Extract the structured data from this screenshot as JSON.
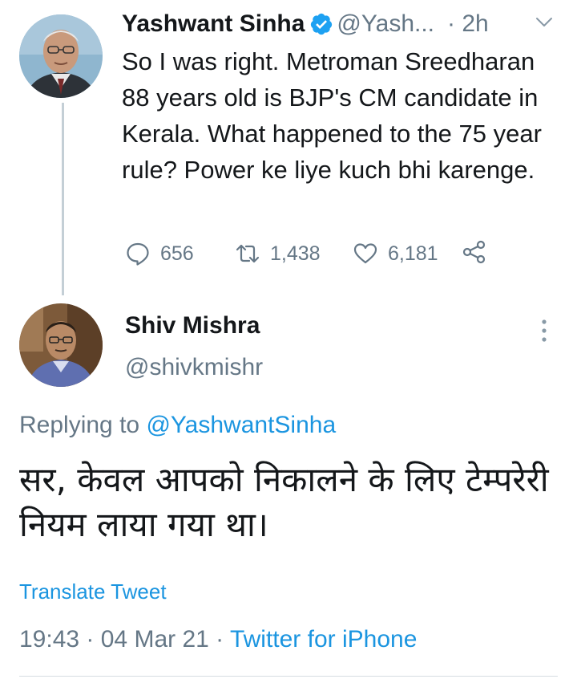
{
  "parent_tweet": {
    "author_name": "Yashwant Sinha",
    "handle": "@Yash...",
    "time": "· 2h",
    "text": "So I was right. Metroman Sreedharan 88 years old is BJP's CM candidate in Kerala. What happened to the 75 year rule? Power ke liye kuch bhi karenge.",
    "replies": "656",
    "retweets": "1,438",
    "likes": "6,181",
    "icons": {
      "verified": "verified-badge-icon",
      "menu": "chevron-down-icon",
      "reply": "reply-icon",
      "retweet": "retweet-icon",
      "like": "heart-icon",
      "share": "share-icon"
    }
  },
  "main_tweet": {
    "author_name": "Shiv Mishra",
    "handle": "@shivkmishr",
    "replying_prefix": "Replying to ",
    "replying_to": "@YashwantSinha",
    "text": "सर, केवल आपको निकालने के लिए टेम्परेरी नियम लाया गया था।",
    "translate_label": "Translate Tweet",
    "time": "19:43",
    "date": "· 04 Mar 21 ·",
    "source": "Twitter for iPhone",
    "icons": {
      "more": "more-vertical-icon"
    }
  },
  "colors": {
    "text": "#14171a",
    "secondary": "#657786",
    "link": "#1b95e0",
    "verified": "#1da1f2",
    "thread_line": "#c4cfd6"
  }
}
